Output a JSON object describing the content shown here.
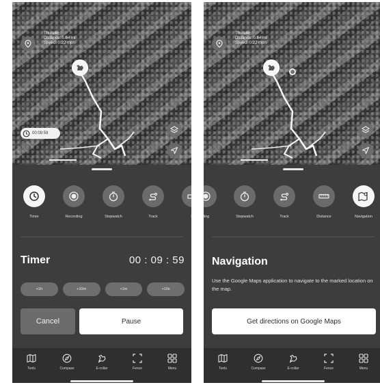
{
  "map": {
    "info_lines": [
      "Thunder",
      "Distance: 0.64 mi",
      "Speed: 0.22 mph"
    ],
    "timer_chip_text": "00:09:59"
  },
  "left_screen": {
    "tools": [
      {
        "label": "Timer",
        "icon": "timer-icon",
        "active": true
      },
      {
        "label": "Recording",
        "icon": "record-icon",
        "active": false
      },
      {
        "label": "Stopwatch",
        "icon": "stopwatch-icon",
        "active": false
      },
      {
        "label": "Track",
        "icon": "track-icon",
        "active": false
      },
      {
        "label": "Di",
        "icon": "distance-icon",
        "active": false
      }
    ],
    "section_title": "Timer",
    "timer_value": "00 : 09 : 59",
    "increments": [
      "+1h",
      "+10m",
      "+1m",
      "+10s"
    ],
    "cancel_label": "Cancel",
    "pause_label": "Pause"
  },
  "right_screen": {
    "tools": [
      {
        "label": "ding",
        "icon": "record-icon",
        "active": false
      },
      {
        "label": "Stopwatch",
        "icon": "stopwatch-icon",
        "active": false
      },
      {
        "label": "Track",
        "icon": "track-icon",
        "active": false
      },
      {
        "label": "Distance",
        "icon": "ruler-icon",
        "active": false
      },
      {
        "label": "Navigation",
        "icon": "map-pin-icon",
        "active": true
      }
    ],
    "section_title": "Navigation",
    "description": "Use the Google Maps application to navigate to the marked location on the map.",
    "directions_label": "Get directions on Google Maps"
  },
  "bottom_nav": {
    "items": [
      {
        "label": "Tools",
        "icon": "map-icon"
      },
      {
        "label": "Compass",
        "icon": "compass-icon"
      },
      {
        "label": "E-collar",
        "icon": "ecollar-icon"
      },
      {
        "label": "Fence",
        "icon": "fence-icon"
      },
      {
        "label": "Menu",
        "icon": "grid-menu-icon"
      }
    ]
  },
  "colors": {
    "sheet_bg": "#3d3d3d",
    "tool_circle": "#6b6b6b",
    "active_tool": "#f6f6f6",
    "primary_button": "#ffffff",
    "nav_bg": "#2f2f2f"
  }
}
